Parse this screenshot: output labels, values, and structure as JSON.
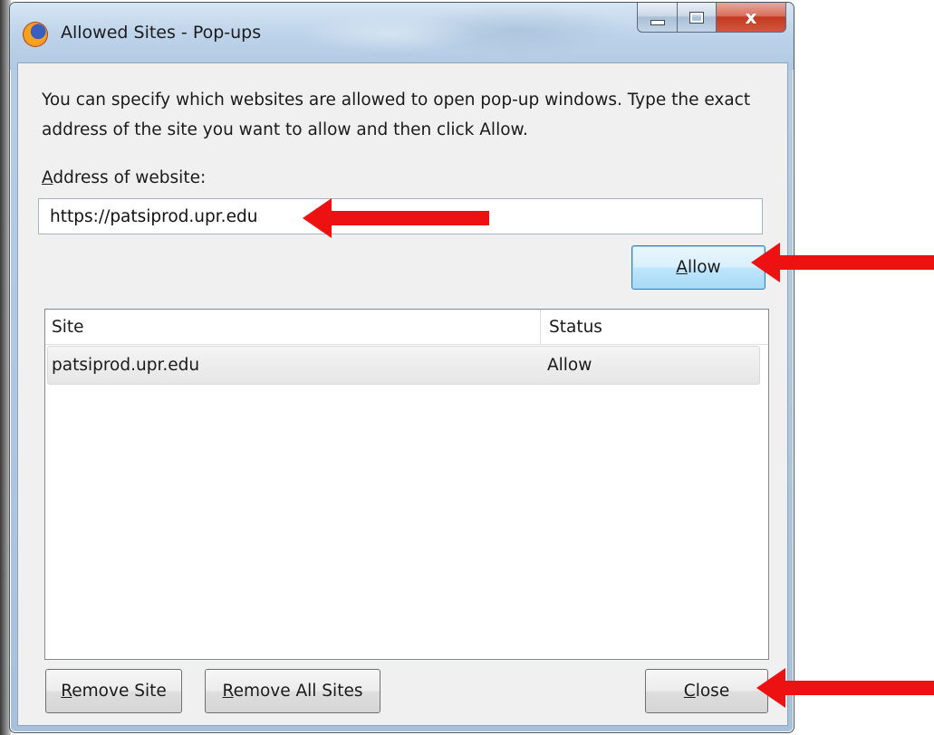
{
  "window": {
    "title": "Allowed Sites - Pop-ups",
    "caption": {
      "close_glyph": "x"
    }
  },
  "dialog": {
    "description": "You can specify which websites are allowed to open pop-up windows. Type the exact address of the site you want to allow and then click Allow.",
    "address_label": "Address of website:",
    "address_value": "https://patsiprod.upr.edu",
    "allow_button": "Allow",
    "remove_site_button": "Remove Site",
    "remove_all_sites_button": "Remove All Sites",
    "close_button": "Close"
  },
  "sites_table": {
    "columns": [
      "Site",
      "Status"
    ],
    "rows": [
      {
        "site": "patsiprod.upr.edu",
        "status": "Allow"
      }
    ]
  },
  "icons": {
    "app": "firefox-icon",
    "minimize": "minimize-icon",
    "maximize": "maximize-icon",
    "close": "close-icon",
    "annotation": "red-arrow-icon"
  },
  "colors": {
    "annotation_arrow": "#ee1111",
    "close_button": "#c2391f",
    "default_button_border": "#3c7fb1"
  }
}
